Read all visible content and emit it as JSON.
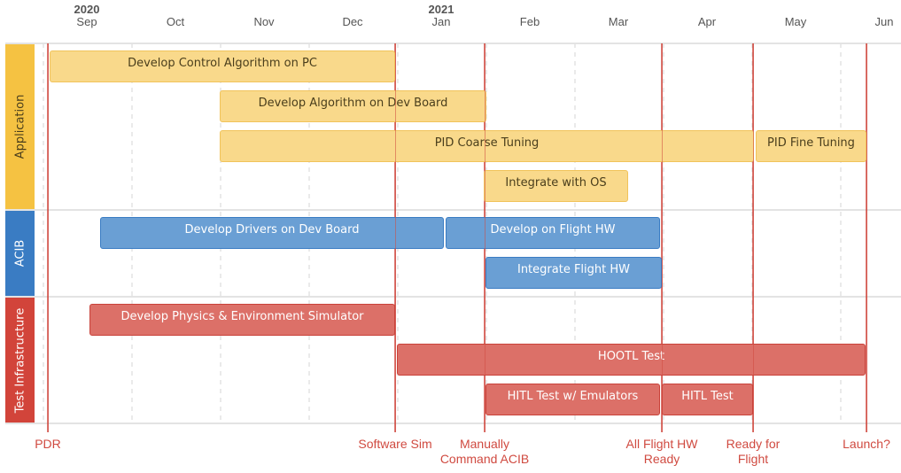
{
  "chart_data": {
    "type": "gantt",
    "title": "",
    "x_unit": "months since 2020-09-01",
    "x_range": [
      -0.05,
      9.7
    ],
    "years": [
      {
        "label": "2020",
        "at": 0.49
      },
      {
        "label": "2021",
        "at": 4.49
      }
    ],
    "months": [
      {
        "label": "Sep",
        "at": 0.49
      },
      {
        "label": "Oct",
        "at": 1.49
      },
      {
        "label": "Nov",
        "at": 2.49
      },
      {
        "label": "Dec",
        "at": 3.49
      },
      {
        "label": "Jan",
        "at": 4.49
      },
      {
        "label": "Feb",
        "at": 5.49
      },
      {
        "label": "Mar",
        "at": 6.49
      },
      {
        "label": "Apr",
        "at": 7.49
      },
      {
        "label": "May",
        "at": 8.49
      },
      {
        "label": "Jun",
        "at": 9.49
      }
    ],
    "gridlines": [
      0,
      1,
      2,
      3,
      4,
      5,
      6,
      7,
      8,
      9
    ],
    "groups": [
      {
        "id": "app",
        "label": "Application",
        "color": "#f5c242",
        "text_color": "#4a3e1c",
        "rows": 4
      },
      {
        "id": "acib",
        "label": "ACIB",
        "color": "#3a7cc3",
        "text_color": "#ffffff",
        "rows": 2
      },
      {
        "id": "test",
        "label": "Test Infrastructure",
        "color": "#d2443a",
        "text_color": "#ffffff",
        "rows": 3
      }
    ],
    "tasks": [
      {
        "group": "app",
        "row": 0,
        "label": "Develop Control Algorithm on PC",
        "start": 0.07,
        "end": 3.97
      },
      {
        "group": "app",
        "row": 1,
        "label": "Develop Algorithm on Dev Board",
        "start": 1.99,
        "end": 5.0
      },
      {
        "group": "app",
        "row": 2,
        "label": "PID Coarse Tuning",
        "start": 1.99,
        "end": 8.02
      },
      {
        "group": "app",
        "row": 2,
        "label": "PID Fine Tuning",
        "start": 8.04,
        "end": 9.29
      },
      {
        "group": "app",
        "row": 3,
        "label": "Integrate with OS",
        "start": 4.97,
        "end": 6.6
      },
      {
        "group": "acib",
        "row": 0,
        "label": "Develop Drivers on Dev Board",
        "start": 0.64,
        "end": 4.52
      },
      {
        "group": "acib",
        "row": 0,
        "label": "Develop on Flight HW",
        "start": 4.54,
        "end": 6.96
      },
      {
        "group": "acib",
        "row": 1,
        "label": "Integrate Flight HW",
        "start": 4.99,
        "end": 6.98
      },
      {
        "group": "test",
        "row": 0,
        "label": "Develop Physics & Environment Simulator",
        "start": 0.52,
        "end": 3.97
      },
      {
        "group": "test",
        "row": 1,
        "label": "HOOTL Test",
        "start": 3.99,
        "end": 9.28
      },
      {
        "group": "test",
        "row": 2,
        "label": "HITL Test w/ Emulators",
        "start": 4.99,
        "end": 6.96
      },
      {
        "group": "test",
        "row": 2,
        "label": "HITL Test",
        "start": 6.98,
        "end": 8.01
      }
    ],
    "milestones": [
      {
        "label": "PDR",
        "at": 0.05
      },
      {
        "label": "Software Sim",
        "at": 3.97
      },
      {
        "label": "Manually\nCommand ACIB",
        "at": 4.98
      },
      {
        "label": "All Flight HW\nReady",
        "at": 6.98
      },
      {
        "label": "Ready for\nFlight",
        "at": 8.01
      },
      {
        "label": "Launch?",
        "at": 9.29
      }
    ],
    "milestone_color": "#d04a40"
  }
}
